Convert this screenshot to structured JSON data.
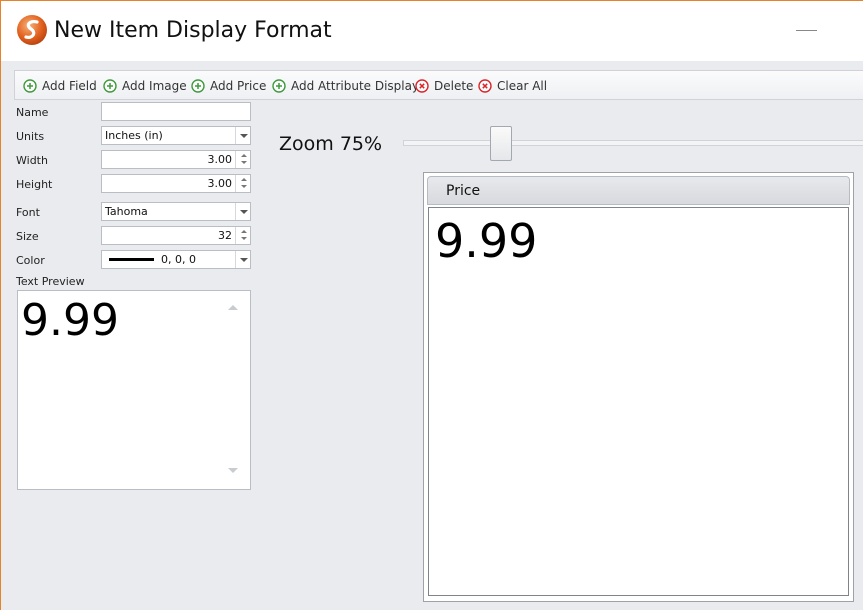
{
  "window": {
    "title": "New Item Display Format",
    "accent_color": "#e8822a"
  },
  "toolbar": {
    "buttons": [
      {
        "label": "Add Field",
        "icon": "plus-circle-icon",
        "color": "#3c9a3c"
      },
      {
        "label": "Add Image",
        "icon": "plus-circle-icon",
        "color": "#3c9a3c"
      },
      {
        "label": "Add Price",
        "icon": "plus-circle-icon",
        "color": "#3c9a3c"
      },
      {
        "label": "Add Attribute Display",
        "icon": "plus-circle-icon",
        "color": "#3c9a3c"
      },
      {
        "label": "Delete",
        "icon": "x-circle-icon",
        "color": "#d9262b"
      },
      {
        "label": "Clear All",
        "icon": "x-circle-icon",
        "color": "#d9262b"
      }
    ]
  },
  "form": {
    "name": {
      "label": "Name",
      "value": ""
    },
    "units": {
      "label": "Units",
      "value": "Inches (in)"
    },
    "width": {
      "label": "Width",
      "value": "3.00"
    },
    "height": {
      "label": "Height",
      "value": "3.00"
    },
    "font": {
      "label": "Font",
      "value": "Tahoma"
    },
    "size": {
      "label": "Size",
      "value": "32"
    },
    "color": {
      "label": "Color",
      "value": "0, 0, 0",
      "swatch": "#000000"
    },
    "text_preview": {
      "label": "Text Preview",
      "value": "9.99"
    }
  },
  "zoom": {
    "label": "Zoom 75%",
    "level_percent": 75
  },
  "canvas": {
    "header": "Price",
    "value": "9.99"
  }
}
